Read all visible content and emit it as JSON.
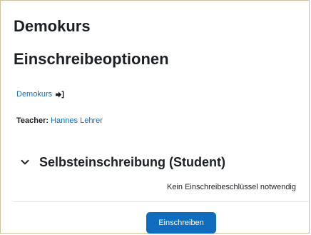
{
  "course": {
    "title": "Demokurs"
  },
  "page": {
    "heading": "Einschreibeoptionen"
  },
  "course_link": {
    "label": "Demokurs",
    "icon": "enrol-arrow-icon"
  },
  "teacher": {
    "label": "Teacher:",
    "name": "Hannes Lehrer"
  },
  "enrolment_method": {
    "title": "Selbsteinschreibung (Student)",
    "note": "Kein Einschreibeschlüssel notwendig",
    "button_label": "Einschreiben",
    "expanded_icon": "chevron-down-icon"
  },
  "colors": {
    "link": "#0f6cbf",
    "button": "#0f6cbf",
    "text": "#1d2125"
  }
}
